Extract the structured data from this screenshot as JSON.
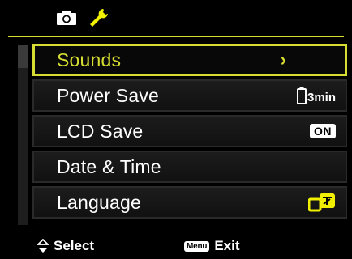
{
  "tabs": [
    {
      "icon": "camera-icon"
    },
    {
      "icon": "wrench-icon",
      "active": true
    }
  ],
  "menu": {
    "items": [
      {
        "label": "Sounds",
        "value_icon": "chevron-right-icon",
        "value_text": "›",
        "selected": true
      },
      {
        "label": "Power Save",
        "value_icon": "battery-icon",
        "value_text": "3min"
      },
      {
        "label": "LCD Save",
        "value_text": "ON"
      },
      {
        "label": "Date & Time"
      },
      {
        "label": "Language",
        "value_icon": "language-icon"
      }
    ]
  },
  "footer": {
    "select_label": "Select",
    "menu_key": "Menu",
    "exit_label": "Exit"
  },
  "colors": {
    "accent": "#d6dc32",
    "accent_icon": "#f0f000",
    "background": "#000000"
  }
}
